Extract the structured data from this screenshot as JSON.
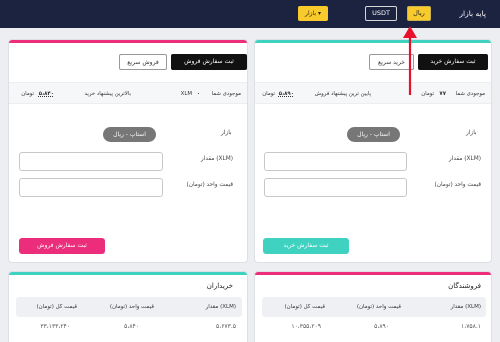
{
  "header": {
    "page_title": "پایه بازار",
    "rial_label": "ریال",
    "usdt_label": "USDT",
    "market_label": "بازار"
  },
  "colors": {
    "header_bg": "#1b2340",
    "accent_yellow": "#f8ca2c",
    "buy": "#3fd2c0",
    "sell": "#ec2d7c",
    "annotation": "#e8112d"
  },
  "buy_panel": {
    "tab_limit": "ثبت سفارش خرید",
    "tab_quick": "خرید سریع",
    "balance_label": "موجودی شما",
    "balance_value": "۷۷",
    "balance_unit": "تومان",
    "best_price_label": "پایین ترین پیشنهاد فروش",
    "best_price_value": "۵،۸۹۰",
    "best_price_unit": "تومان",
    "market_label": "بازار",
    "order_type": "استاپ - ریال",
    "amount_label": "مقدار (XLM)",
    "price_label": "قیمت واحد (تومان)",
    "submit_label": "ثبت سفارش خرید"
  },
  "sell_panel": {
    "tab_limit": "ثبت سفارش فروش",
    "tab_quick": "فروش سریع",
    "balance_label": "موجودی شما",
    "balance_value": "۰",
    "balance_unit": "XLM",
    "best_price_label": "بالاترین پیشنهاد خرید",
    "best_price_value": "۵،۸۴۰",
    "best_price_unit": "تومان",
    "market_label": "بازار",
    "order_type": "استاپ - ریال",
    "amount_label": "مقدار (XLM)",
    "price_label": "قیمت واحد (تومان)",
    "submit_label": "ثبت سفارش فروش"
  },
  "sellers": {
    "title": "فروشندگان",
    "columns": [
      "مقدار (XLM)",
      "قیمت واحد (تومان)",
      "قیمت کل (تومان)"
    ],
    "rows": [
      [
        "۱،۷۵۸.۱",
        "۵،۸۹۰",
        "۱۰،۳۵۵،۲۰۹"
      ]
    ]
  },
  "buyers": {
    "title": "خریداران",
    "columns": [
      "مقدار (XLM)",
      "قیمت واحد (تومان)",
      "قیمت کل (تومان)"
    ],
    "rows": [
      [
        "۵،۶۷۳.۵",
        "۵،۸۴۰",
        "۳۳،۱۳۳،۲۴۰"
      ]
    ]
  }
}
